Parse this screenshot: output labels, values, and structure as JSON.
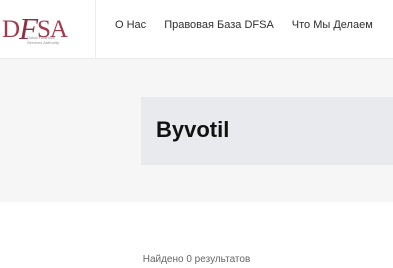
{
  "logo": {
    "mark_d": "D",
    "mark_f": "F",
    "mark_sa": "SA",
    "sub_lines": [
      "Dubai Financial",
      "Services Authority"
    ]
  },
  "nav": {
    "items": [
      {
        "label": "О Нас"
      },
      {
        "label": "Правовая База DFSA"
      },
      {
        "label": "Что Мы Делаем"
      }
    ]
  },
  "page": {
    "title": "Byvotil"
  },
  "search": {
    "results_text": "Найдено 0 результатов"
  },
  "colors": {
    "brand": "#a23a4c",
    "hero_bg": "#f6f6f7",
    "title_bg": "#e9eaed"
  }
}
